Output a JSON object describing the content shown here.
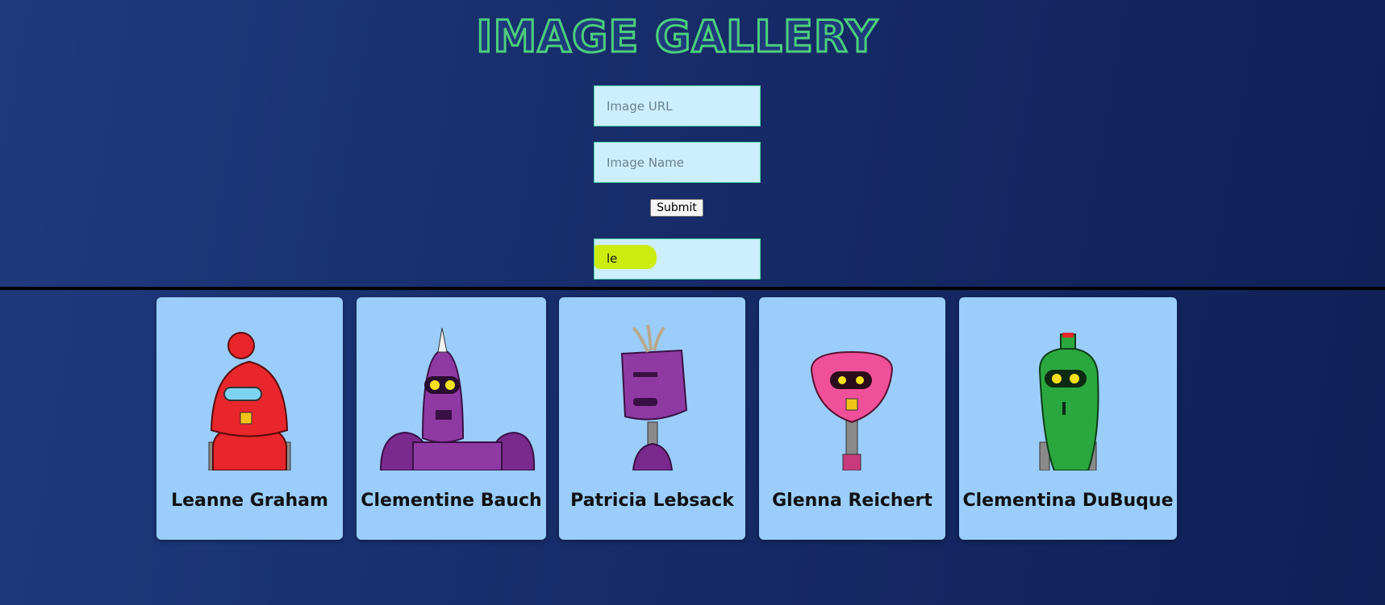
{
  "header": {
    "title": "IMAGE GALLERY"
  },
  "form": {
    "url_placeholder": "Image URL",
    "name_placeholder": "Image Name",
    "submit_label": "Submit",
    "search_value": "le"
  },
  "gallery": {
    "robots": [
      {
        "name": "Leanne Graham",
        "icon": "red-robot-icon",
        "color": "#e8262b"
      },
      {
        "name": "Clementine Bauch",
        "icon": "purple-robot-icon",
        "color": "#7a2a8c"
      },
      {
        "name": "Patricia Lebsack",
        "icon": "purple-robot-icon",
        "color": "#7a2a8c"
      },
      {
        "name": "Glenna Reichert",
        "icon": "pink-robot-icon",
        "color": "#f0509a"
      },
      {
        "name": "Clementina DuBuque",
        "icon": "green-robot-icon",
        "color": "#2aa83f"
      }
    ]
  },
  "colors": {
    "background": "#172c69",
    "title_outline": "#4ccf7c",
    "card": "#9acdfa",
    "search_highlight": "#ccec0f"
  }
}
